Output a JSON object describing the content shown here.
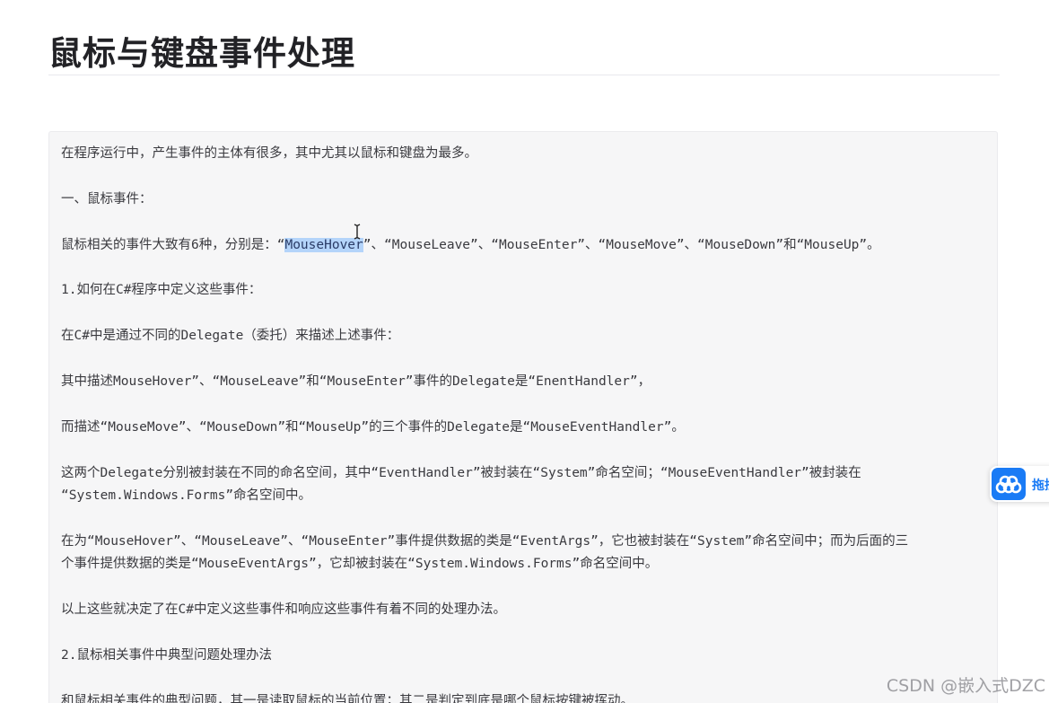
{
  "article": {
    "title": "鼠标与键盘事件处理"
  },
  "content": {
    "p1": "在程序运行中，产生事件的主体有很多，其中尤其以鼠标和键盘为最多。",
    "h1": "一、鼠标事件：",
    "p2_before": "鼠标相关的事件大致有6种，分别是：“",
    "p2_selected": "MouseHover",
    "p2_after": "”、“MouseLeave”、“MouseEnter”、“MouseMove”、“MouseDown”和“MouseUp”。",
    "h2": "1.如何在C#程序中定义这些事件：",
    "p3": "在C#中是通过不同的Delegate（委托）来描述上述事件：",
    "p4": "其中描述MouseHover”、“MouseLeave”和“MouseEnter”事件的Delegate是“EnentHandler”，",
    "p5": "而描述“MouseMove”、“MouseDown”和“MouseUp”的三个事件的Delegate是“MouseEventHandler”。",
    "p6_l1": "这两个Delegate分别被封装在不同的命名空间，其中“EventHandler”被封装在“System”命名空间；“MouseEventHandler”被封装在",
    "p6_l2": "“System.Windows.Forms”命名空间中。",
    "p7_l1": "在为“MouseHover”、“MouseLeave”、“MouseEnter”事件提供数据的类是“EventArgs”，它也被封装在“System”命名空间中；而为后面的三",
    "p7_l2": "个事件提供数据的类是“MouseEventArgs”，它却被封装在“System.Windows.Forms”命名空间中。",
    "p8": "以上这些就决定了在C#中定义这些事件和响应这些事件有着不同的处理办法。",
    "h3": "2.鼠标相关事件中典型问题处理办法",
    "p9": "和鼠标相关事件的典型问题，其一是读取鼠标的当前位置；其二是判定到底是哪个鼠标按键被挥动。"
  },
  "float_tab": {
    "label": "拖拽",
    "icon": "cloud-icon",
    "color": "#1a7bf5"
  },
  "watermark": {
    "text": "CSDN @嵌入式DZC"
  },
  "colors": {
    "selection": "#b4d4fa",
    "block_background": "#f6f6f7"
  }
}
